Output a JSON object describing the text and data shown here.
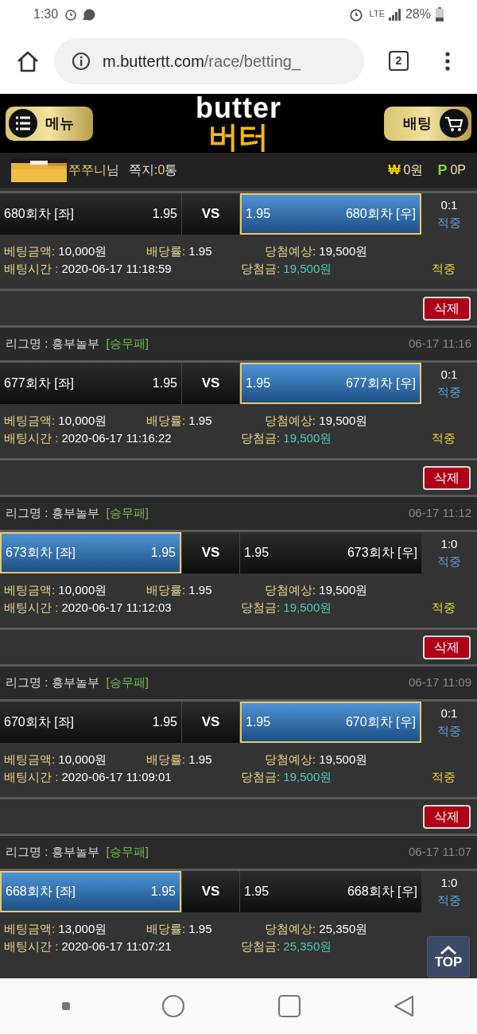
{
  "status_bar": {
    "time": "1:30",
    "network": "LTE",
    "battery": "28%"
  },
  "browser": {
    "url_domain": "m.buttertt.com",
    "url_path": "/race/betting_",
    "tab_count": "2"
  },
  "header": {
    "menu_button": "메뉴",
    "logo_top": "butter",
    "logo_bottom": "버터",
    "bet_button": "배팅"
  },
  "user_bar": {
    "nickname": "쭈쭈니",
    "honorific": "님",
    "messages_label": "쪽지:",
    "messages_count": "0",
    "messages_unit": "통",
    "won_symbol": "₩",
    "money": "0원",
    "point_symbol": "P",
    "points": "0P"
  },
  "bets": [
    {
      "left": {
        "name": "680회차 [좌]",
        "odds": "1.95",
        "selected": false
      },
      "vs": "VS",
      "right": {
        "name": "680회차 [우]",
        "odds": "1.95",
        "selected": true
      },
      "score": "0:1",
      "result": "적중",
      "amount_label": "베팅금액:",
      "amount": "10,000원",
      "odds_label": "배당률:",
      "odds": "1.95",
      "expected_label": "당첨예상:",
      "expected": "19,500원",
      "time_label": "배팅시간 :",
      "time": "2020-06-17 11:18:59",
      "win_label": "당첨금:",
      "win": "19,500원",
      "status": "적중",
      "delete_button": "삭제"
    },
    {
      "league_label": "리그명 : 흥부놀부",
      "market": "[승무패]",
      "date": "06-17 11:16",
      "left": {
        "name": "677회차 [좌]",
        "odds": "1.95",
        "selected": false
      },
      "vs": "VS",
      "right": {
        "name": "677회차 [우]",
        "odds": "1.95",
        "selected": true
      },
      "score": "0:1",
      "result": "적중",
      "amount_label": "베팅금액:",
      "amount": "10,000원",
      "odds_label": "배당률:",
      "odds": "1.95",
      "expected_label": "당첨예상:",
      "expected": "19,500원",
      "time_label": "배팅시간 :",
      "time": "2020-06-17 11:16:22",
      "win_label": "당첨금:",
      "win": "19,500원",
      "status": "적중",
      "delete_button": "삭제"
    },
    {
      "league_label": "리그명 : 흥부놀부",
      "market": "[승무패]",
      "date": "06-17 11:12",
      "left": {
        "name": "673회차 [좌]",
        "odds": "1.95",
        "selected": true
      },
      "vs": "VS",
      "right": {
        "name": "673회차 [우]",
        "odds": "1.95",
        "selected": false
      },
      "score": "1:0",
      "result": "적중",
      "amount_label": "베팅금액:",
      "amount": "10,000원",
      "odds_label": "배당률:",
      "odds": "1.95",
      "expected_label": "당첨예상:",
      "expected": "19,500원",
      "time_label": "배팅시간 :",
      "time": "2020-06-17 11:12:03",
      "win_label": "당첨금:",
      "win": "19,500원",
      "status": "적중",
      "delete_button": "삭제"
    },
    {
      "league_label": "리그명 : 흥부놀부",
      "market": "[승무패]",
      "date": "06-17 11:09",
      "left": {
        "name": "670회차 [좌]",
        "odds": "1.95",
        "selected": false
      },
      "vs": "VS",
      "right": {
        "name": "670회차 [우]",
        "odds": "1.95",
        "selected": true
      },
      "score": "0:1",
      "result": "적중",
      "amount_label": "베팅금액:",
      "amount": "10,000원",
      "odds_label": "배당률:",
      "odds": "1.95",
      "expected_label": "당첨예상:",
      "expected": "19,500원",
      "time_label": "배팅시간 :",
      "time": "2020-06-17 11:09:01",
      "win_label": "당첨금:",
      "win": "19,500원",
      "status": "적중",
      "delete_button": "삭제"
    },
    {
      "league_label": "리그명 : 흥부놀부",
      "market": "[승무패]",
      "date": "06-17 11:07",
      "left": {
        "name": "668회차 [좌]",
        "odds": "1.95",
        "selected": true
      },
      "vs": "VS",
      "right": {
        "name": "668회차 [우]",
        "odds": "1.95",
        "selected": false
      },
      "score": "1:0",
      "result": "적중",
      "amount_label": "베팅금액:",
      "amount": "13,000원",
      "odds_label": "배당률:",
      "odds": "1.95",
      "expected_label": "당첨예상:",
      "expected": "25,350원",
      "time_label": "배팅시간 :",
      "time": "2020-06-17 11:07:21",
      "win_label": "당첨금:",
      "win": "25,350원"
    }
  ],
  "top_button": "TOP"
}
